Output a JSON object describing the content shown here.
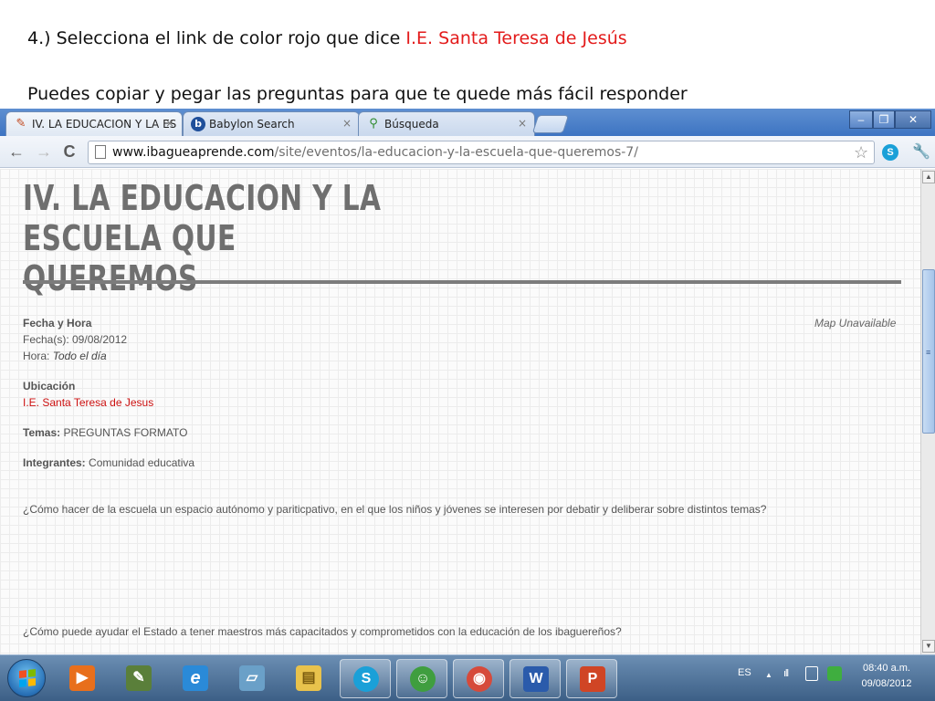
{
  "instructions": {
    "line1_prefix": "4.) Selecciona el link de color rojo que dice ",
    "line1_highlight": "I.E. Santa Teresa de Jesús",
    "line2": "Puedes copiar y pegar las preguntas  para que te quede más fácil  responder"
  },
  "browser": {
    "tabs": [
      {
        "label": "IV. LA EDUCACION Y LA ES",
        "icon": "pencil-favicon",
        "active": true
      },
      {
        "label": "Babylon Search",
        "icon": "babylon-favicon",
        "active": false
      },
      {
        "label": "Búsqueda",
        "icon": "search-favicon",
        "active": false
      }
    ],
    "tab_close": "×",
    "window_buttons": {
      "minimize": "–",
      "restore": "❐",
      "close": "✕"
    },
    "nav": {
      "back": "←",
      "forward": "→",
      "reload": "C"
    },
    "url_host": "www.ibagueaprende.com",
    "url_path": "/site/eventos/la-educacion-y-la-escuela-que-queremos-7/",
    "bookmark_star": "☆",
    "extension_icon": "S",
    "wrench": "🔧"
  },
  "page": {
    "title_line1": "IV. LA EDUCACION Y LA ESCUELA QUE",
    "title_line2": "QUEREMOS",
    "fecha_heading": "Fecha y Hora",
    "fecha_label": "Fecha(s): 09/08/2012",
    "hora_label": "Hora: ",
    "hora_value": "Todo el día",
    "map_note": "Map Unavailable",
    "ubicacion_heading": "Ubicación",
    "ubicacion_link": "I.E. Santa Teresa de Jesus",
    "temas_label": "Temas:",
    "temas_value": " PREGUNTAS FORMATO",
    "integrantes_label": "Integrantes:",
    "integrantes_value": " Comunidad educativa",
    "question1": "¿Cómo hacer de la escuela un espacio autónomo y pariticpativo, en el que los niños y jóvenes se interesen por debatir y deliberar sobre distintos temas?",
    "question2": "¿Cómo puede ayudar el Estado a tener maestros más capacitados y comprometidos con la educación de los ibaguereños?"
  },
  "scrollbar": {
    "up": "▲",
    "down": "▼",
    "grip": "≡"
  },
  "taskbar": {
    "apps": [
      {
        "name": "media-player",
        "glyph": "▶",
        "color": "#e86f1c"
      },
      {
        "name": "network-tool",
        "glyph": "✎",
        "color": "#5a7f3a"
      },
      {
        "name": "internet-explorer",
        "glyph": "e",
        "color": "#2a8ad8"
      },
      {
        "name": "notes",
        "glyph": "▱",
        "color": "#6aa0c8"
      },
      {
        "name": "file-explorer",
        "glyph": "▤",
        "color": "#e8c24c"
      },
      {
        "name": "skype",
        "glyph": "S",
        "color": "#1aa0d8"
      },
      {
        "name": "messenger",
        "glyph": "☺",
        "color": "#3f9e3f"
      },
      {
        "name": "chrome",
        "glyph": "◉",
        "color": "#d64a3b"
      },
      {
        "name": "word",
        "glyph": "W",
        "color": "#2b5bab"
      },
      {
        "name": "powerpoint",
        "glyph": "P",
        "color": "#d04525"
      }
    ],
    "language": "ES",
    "tray_arrow": "▲",
    "signal": "ıll",
    "time": "08:40 a.m.",
    "date": "09/08/2012"
  }
}
